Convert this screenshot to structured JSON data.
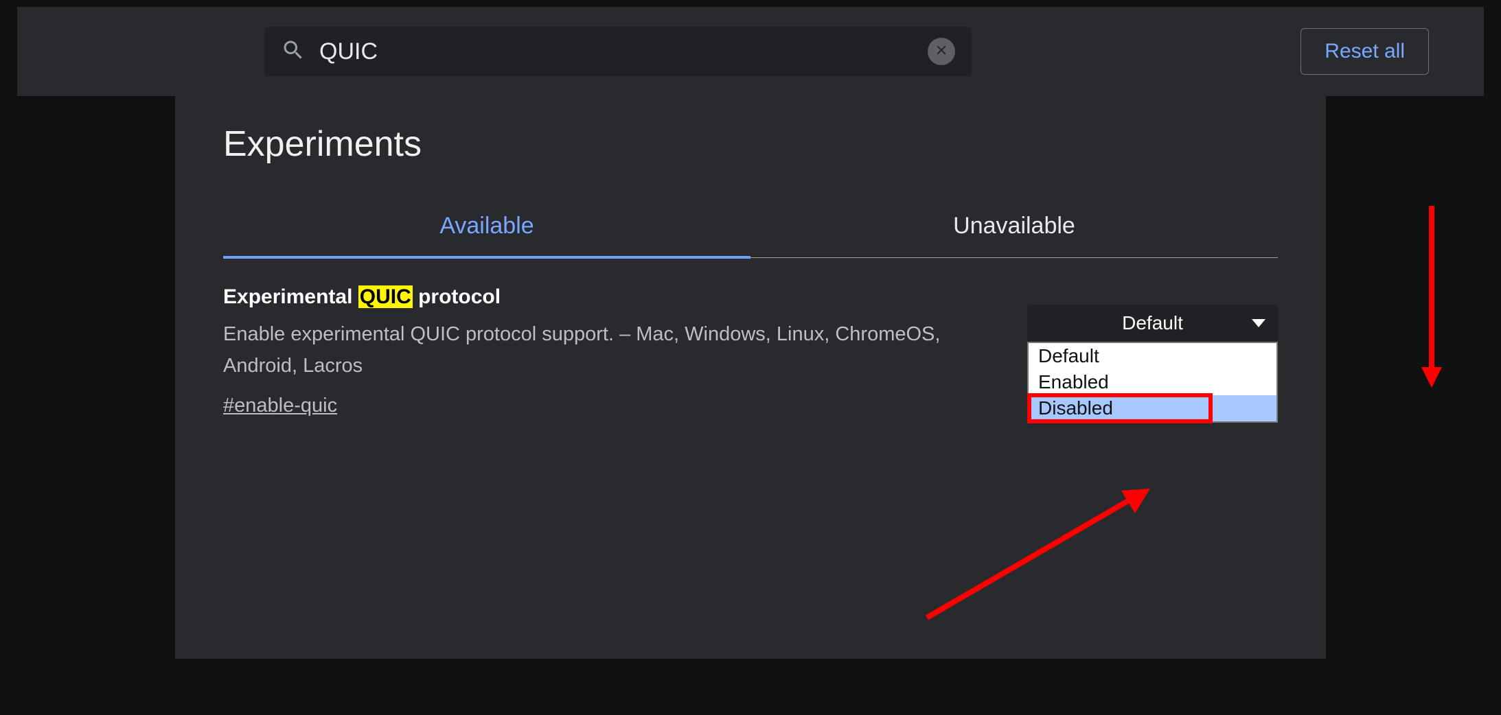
{
  "search": {
    "value": "QUIC"
  },
  "reset_label": "Reset all",
  "page_title": "Experiments",
  "tabs": {
    "available": "Available",
    "unavailable": "Unavailable"
  },
  "flag": {
    "title_pre": "Experimental ",
    "title_hl": "QUIC",
    "title_post": " protocol",
    "desc": "Enable experimental QUIC protocol support. – Mac, Windows, Linux, ChromeOS, Android, Lacros",
    "hash": "#enable-quic"
  },
  "dropdown": {
    "selected": "Default",
    "options": [
      "Default",
      "Enabled",
      "Disabled"
    ]
  }
}
